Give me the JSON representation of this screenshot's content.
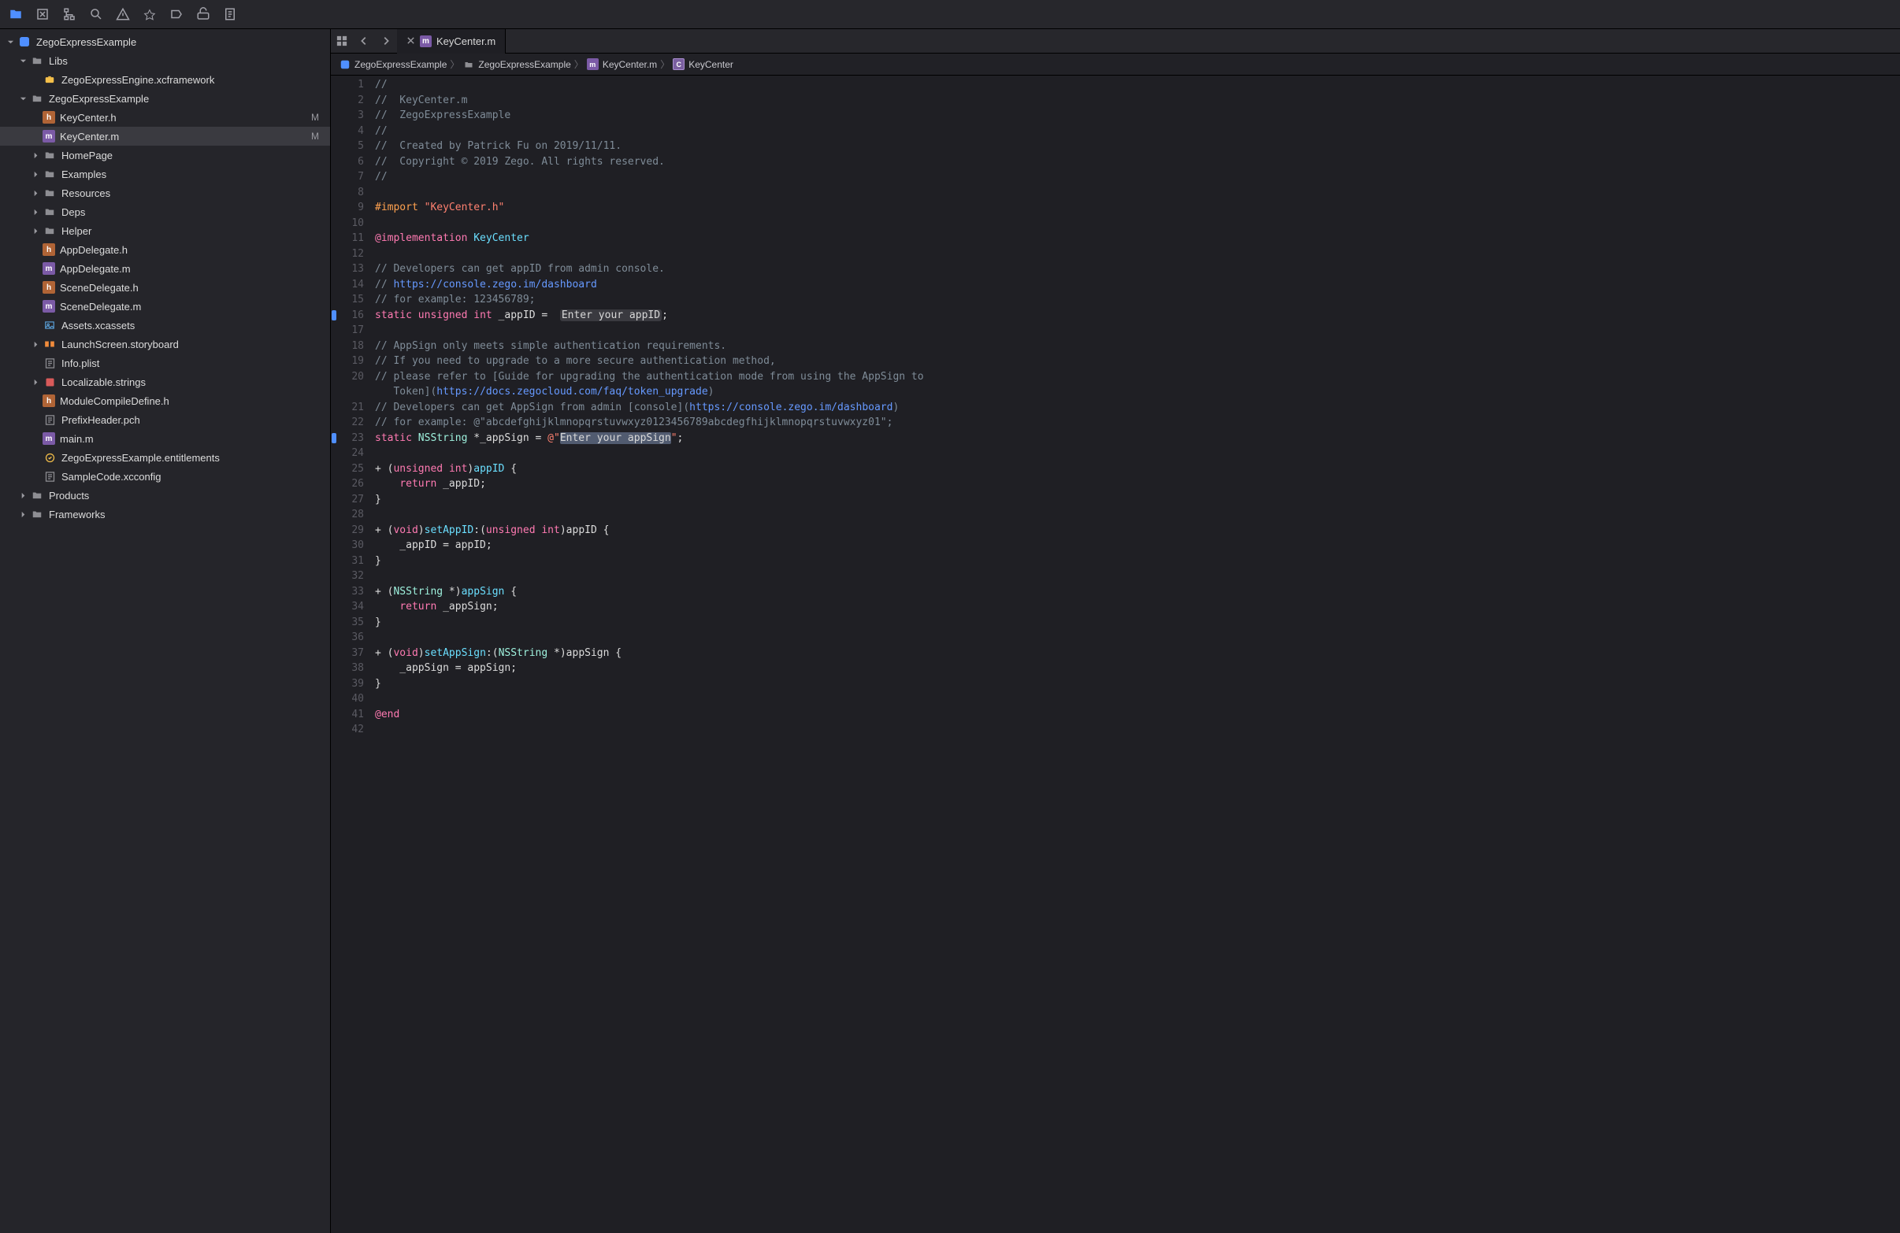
{
  "toolbar": {
    "icons": [
      "folder",
      "source-control",
      "hierarchy",
      "search",
      "warnings",
      "tags",
      "breakpoints",
      "reports",
      "docs"
    ]
  },
  "sidebar": {
    "root": {
      "label": "ZegoExpressExample",
      "kind": "app"
    },
    "items": [
      {
        "indent": 1,
        "disclosure": "down",
        "kind": "folder",
        "label": "Libs"
      },
      {
        "indent": 2,
        "kind": "fw",
        "label": "ZegoExpressEngine.xcframework"
      },
      {
        "indent": 1,
        "disclosure": "down",
        "kind": "folder",
        "label": "ZegoExpressExample"
      },
      {
        "indent": 2,
        "kind": "h",
        "label": "KeyCenter.h",
        "badge": "M"
      },
      {
        "indent": 2,
        "kind": "m",
        "label": "KeyCenter.m",
        "badge": "M",
        "selected": true
      },
      {
        "indent": 2,
        "disclosure": "right",
        "kind": "folder",
        "label": "HomePage"
      },
      {
        "indent": 2,
        "disclosure": "right",
        "kind": "folder",
        "label": "Examples"
      },
      {
        "indent": 2,
        "disclosure": "right",
        "kind": "folder",
        "label": "Resources"
      },
      {
        "indent": 2,
        "disclosure": "right",
        "kind": "folder",
        "label": "Deps"
      },
      {
        "indent": 2,
        "disclosure": "right",
        "kind": "folder",
        "label": "Helper"
      },
      {
        "indent": 2,
        "kind": "h",
        "label": "AppDelegate.h"
      },
      {
        "indent": 2,
        "kind": "m",
        "label": "AppDelegate.m"
      },
      {
        "indent": 2,
        "kind": "h",
        "label": "SceneDelegate.h"
      },
      {
        "indent": 2,
        "kind": "m",
        "label": "SceneDelegate.m"
      },
      {
        "indent": 2,
        "kind": "assets",
        "label": "Assets.xcassets"
      },
      {
        "indent": 2,
        "disclosure": "right",
        "kind": "sb",
        "label": "LaunchScreen.storyboard"
      },
      {
        "indent": 2,
        "kind": "plist",
        "label": "Info.plist"
      },
      {
        "indent": 2,
        "disclosure": "right",
        "kind": "strings",
        "label": "Localizable.strings"
      },
      {
        "indent": 2,
        "kind": "h",
        "label": "ModuleCompileDefine.h"
      },
      {
        "indent": 2,
        "kind": "plist",
        "label": "PrefixHeader.pch"
      },
      {
        "indent": 2,
        "kind": "m",
        "label": "main.m"
      },
      {
        "indent": 2,
        "kind": "ent",
        "label": "ZegoExpressExample.entitlements"
      },
      {
        "indent": 2,
        "kind": "plist",
        "label": "SampleCode.xcconfig"
      },
      {
        "indent": 1,
        "disclosure": "right",
        "kind": "folder",
        "label": "Products"
      },
      {
        "indent": 1,
        "disclosure": "right",
        "kind": "folder",
        "label": "Frameworks"
      }
    ]
  },
  "tab": {
    "label": "KeyCenter.m"
  },
  "jumpbar": {
    "segments": [
      {
        "kind": "app",
        "label": "ZegoExpressExample"
      },
      {
        "kind": "folder",
        "label": "ZegoExpressExample"
      },
      {
        "kind": "m",
        "label": "KeyCenter.m"
      },
      {
        "kind": "c",
        "label": "KeyCenter"
      }
    ]
  },
  "code": {
    "lines": [
      {
        "n": 1,
        "t": [
          [
            "c-comment",
            "//"
          ]
        ]
      },
      {
        "n": 2,
        "t": [
          [
            "c-comment",
            "//  KeyCenter.m"
          ]
        ]
      },
      {
        "n": 3,
        "t": [
          [
            "c-comment",
            "//  ZegoExpressExample"
          ]
        ]
      },
      {
        "n": 4,
        "t": [
          [
            "c-comment",
            "//"
          ]
        ]
      },
      {
        "n": 5,
        "t": [
          [
            "c-comment",
            "//  Created by Patrick Fu on 2019/11/11."
          ]
        ]
      },
      {
        "n": 6,
        "t": [
          [
            "c-comment",
            "//  Copyright © 2019 Zego. All rights reserved."
          ]
        ]
      },
      {
        "n": 7,
        "t": [
          [
            "c-comment",
            "//"
          ]
        ]
      },
      {
        "n": 8,
        "t": [
          [
            "c-plain",
            ""
          ]
        ]
      },
      {
        "n": 9,
        "t": [
          [
            "c-preproc",
            "#import "
          ],
          [
            "c-string",
            "\"KeyCenter.h\""
          ]
        ]
      },
      {
        "n": 10,
        "t": [
          [
            "c-plain",
            ""
          ]
        ]
      },
      {
        "n": 11,
        "t": [
          [
            "c-keyword",
            "@implementation"
          ],
          [
            "c-plain",
            " "
          ],
          [
            "c-typedef",
            "KeyCenter"
          ]
        ]
      },
      {
        "n": 12,
        "t": [
          [
            "c-plain",
            ""
          ]
        ]
      },
      {
        "n": 13,
        "t": [
          [
            "c-comment",
            "// Developers can get appID from admin console."
          ]
        ]
      },
      {
        "n": 14,
        "t": [
          [
            "c-comment",
            "// "
          ],
          [
            "c-url",
            "https://console.zego.im/dashboard"
          ]
        ]
      },
      {
        "n": 15,
        "t": [
          [
            "c-comment",
            "// for example: 123456789;"
          ]
        ]
      },
      {
        "n": 16,
        "mark": true,
        "t": [
          [
            "c-keyword",
            "static"
          ],
          [
            "c-plain",
            " "
          ],
          [
            "c-keyword",
            "unsigned"
          ],
          [
            "c-plain",
            " "
          ],
          [
            "c-keyword",
            "int"
          ],
          [
            "c-plain",
            " _appID =  "
          ],
          [
            "hl-gray",
            "Enter your appID"
          ],
          [
            "c-plain",
            ";"
          ]
        ]
      },
      {
        "n": 17,
        "t": [
          [
            "c-plain",
            ""
          ]
        ]
      },
      {
        "n": 18,
        "t": [
          [
            "c-comment",
            "// AppSign only meets simple authentication requirements."
          ]
        ]
      },
      {
        "n": 19,
        "t": [
          [
            "c-comment",
            "// If you need to upgrade to a more secure authentication method,"
          ]
        ]
      },
      {
        "n": 20,
        "t": [
          [
            "c-comment",
            "// please refer to [Guide for upgrading the authentication mode from using the AppSign to"
          ]
        ]
      },
      {
        "n": 0,
        "cont": true,
        "t": [
          [
            "c-comment",
            "   Token]("
          ],
          [
            "c-url",
            "https://docs.zegocloud.com/faq/token_upgrade"
          ],
          [
            "c-comment",
            ")"
          ]
        ]
      },
      {
        "n": 21,
        "t": [
          [
            "c-comment",
            "// Developers can get AppSign from admin [console]("
          ],
          [
            "c-url",
            "https://console.zego.im/dashboard"
          ],
          [
            "c-comment",
            ")"
          ]
        ]
      },
      {
        "n": 22,
        "t": [
          [
            "c-comment",
            "// for example: @\"abcdefghijklmnopqrstuvwxyz0123456789abcdegfhijklmnopqrstuvwxyz01\";"
          ]
        ]
      },
      {
        "n": 23,
        "mark": true,
        "t": [
          [
            "c-keyword",
            "static"
          ],
          [
            "c-plain",
            " "
          ],
          [
            "c-type",
            "NSString"
          ],
          [
            "c-plain",
            " *_appSign = "
          ],
          [
            "c-string",
            "@\""
          ],
          [
            "hl-sel",
            "Enter your appSign"
          ],
          [
            "c-string",
            "\""
          ],
          [
            "c-plain",
            ";"
          ]
        ]
      },
      {
        "n": 24,
        "t": [
          [
            "c-plain",
            ""
          ]
        ]
      },
      {
        "n": 25,
        "t": [
          [
            "c-plain",
            "+ ("
          ],
          [
            "c-keyword",
            "unsigned"
          ],
          [
            "c-plain",
            " "
          ],
          [
            "c-keyword",
            "int"
          ],
          [
            "c-plain",
            ")"
          ],
          [
            "c-func",
            "appID"
          ],
          [
            "c-plain",
            " {"
          ]
        ]
      },
      {
        "n": 26,
        "t": [
          [
            "c-plain",
            "    "
          ],
          [
            "c-keyword",
            "return"
          ],
          [
            "c-plain",
            " _appID;"
          ]
        ]
      },
      {
        "n": 27,
        "t": [
          [
            "c-plain",
            "}"
          ]
        ]
      },
      {
        "n": 28,
        "t": [
          [
            "c-plain",
            ""
          ]
        ]
      },
      {
        "n": 29,
        "t": [
          [
            "c-plain",
            "+ ("
          ],
          [
            "c-keyword",
            "void"
          ],
          [
            "c-plain",
            ")"
          ],
          [
            "c-func",
            "setAppID"
          ],
          [
            "c-plain",
            ":("
          ],
          [
            "c-keyword",
            "unsigned"
          ],
          [
            "c-plain",
            " "
          ],
          [
            "c-keyword",
            "int"
          ],
          [
            "c-plain",
            ")appID {"
          ]
        ]
      },
      {
        "n": 30,
        "t": [
          [
            "c-plain",
            "    _appID = appID;"
          ]
        ]
      },
      {
        "n": 31,
        "t": [
          [
            "c-plain",
            "}"
          ]
        ]
      },
      {
        "n": 32,
        "t": [
          [
            "c-plain",
            ""
          ]
        ]
      },
      {
        "n": 33,
        "t": [
          [
            "c-plain",
            "+ ("
          ],
          [
            "c-type",
            "NSString"
          ],
          [
            "c-plain",
            " *)"
          ],
          [
            "c-func",
            "appSign"
          ],
          [
            "c-plain",
            " {"
          ]
        ]
      },
      {
        "n": 34,
        "t": [
          [
            "c-plain",
            "    "
          ],
          [
            "c-keyword",
            "return"
          ],
          [
            "c-plain",
            " _appSign;"
          ]
        ]
      },
      {
        "n": 35,
        "t": [
          [
            "c-plain",
            "}"
          ]
        ]
      },
      {
        "n": 36,
        "t": [
          [
            "c-plain",
            ""
          ]
        ]
      },
      {
        "n": 37,
        "t": [
          [
            "c-plain",
            "+ ("
          ],
          [
            "c-keyword",
            "void"
          ],
          [
            "c-plain",
            ")"
          ],
          [
            "c-func",
            "setAppSign"
          ],
          [
            "c-plain",
            ":("
          ],
          [
            "c-type",
            "NSString"
          ],
          [
            "c-plain",
            " *)appSign {"
          ]
        ]
      },
      {
        "n": 38,
        "t": [
          [
            "c-plain",
            "    _appSign = appSign;"
          ]
        ]
      },
      {
        "n": 39,
        "t": [
          [
            "c-plain",
            "}"
          ]
        ]
      },
      {
        "n": 40,
        "t": [
          [
            "c-plain",
            ""
          ]
        ]
      },
      {
        "n": 41,
        "t": [
          [
            "c-keyword",
            "@end"
          ]
        ]
      },
      {
        "n": 42,
        "t": [
          [
            "c-plain",
            ""
          ]
        ]
      }
    ]
  }
}
